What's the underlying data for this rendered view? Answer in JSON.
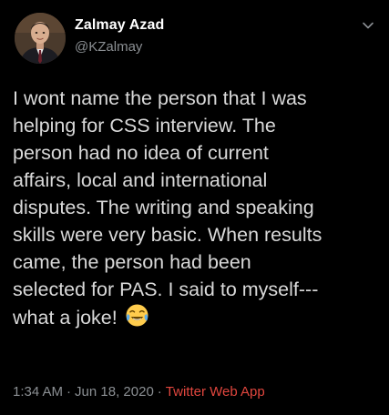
{
  "author": {
    "display_name": "Zalmay Azad",
    "handle": "@KZalmay"
  },
  "tweet": {
    "lines": [
      "I wont name the person that I was",
      "helping for CSS interview. The",
      "person had no idea of current",
      "affairs, local and international",
      "disputes. The writing and speaking",
      "skills were very basic. When results",
      "came, the person had been",
      "selected for PAS. I said to myself---",
      "what a joke!"
    ],
    "emoji": "face-with-tears-of-joy"
  },
  "meta": {
    "time": "1:34 AM",
    "separator": "·",
    "date": "Jun 18, 2020",
    "source": "Twitter Web App"
  },
  "colors": {
    "background": "#000000",
    "text": "#d9d9d9",
    "muted": "#8b8f93",
    "source_link": "#e1463e"
  },
  "icons": {
    "menu": "chevron-down-icon"
  }
}
